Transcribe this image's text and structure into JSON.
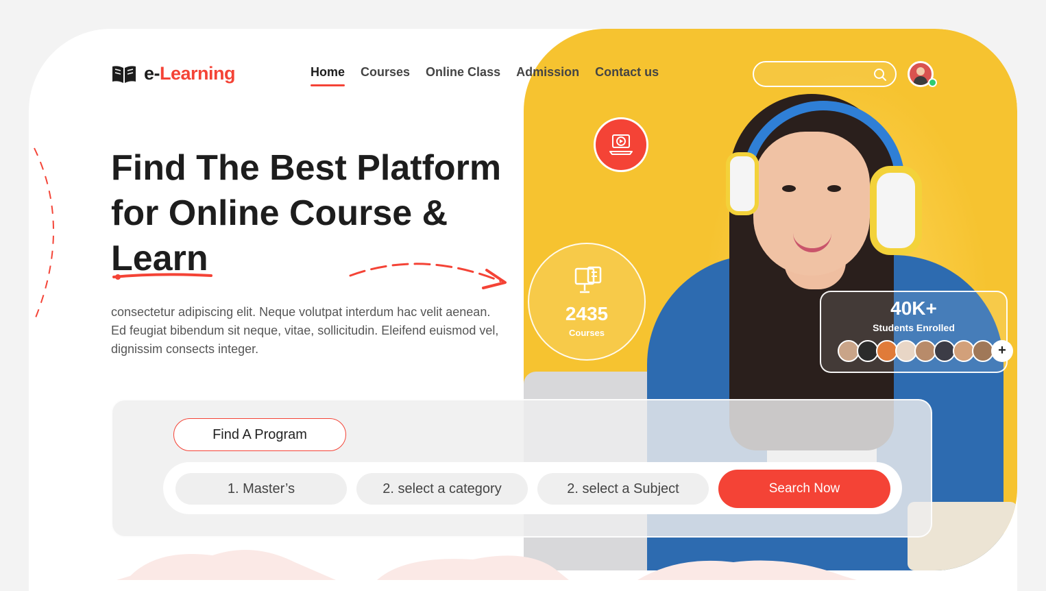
{
  "brand": {
    "name_prefix": "e-",
    "name_accent": "Learning"
  },
  "nav": {
    "items": [
      {
        "label": "Home",
        "active": true
      },
      {
        "label": "Courses"
      },
      {
        "label": "Online Class"
      },
      {
        "label": "Admission"
      },
      {
        "label": "Contact us"
      }
    ]
  },
  "search": {
    "placeholder": ""
  },
  "hero": {
    "headline_line1": "Find The Best Platform",
    "headline_line2": "for Online Course &",
    "headline_line3": "Learn",
    "description": "consectetur adipiscing elit. Neque volutpat interdum hac velit aenean. Ed feugiat bibendum sit neque, vitae, sollicitudin. Eleifend euismod vel, dignissim consects integer."
  },
  "stats": {
    "courses_count": "2435",
    "courses_label": "Courses",
    "students_count": "40K+",
    "students_label": "Students Enrolled",
    "more_label": "+"
  },
  "finder": {
    "tab_label": "Find A Program",
    "filter_degree": "1. Master’s",
    "filter_category": "2. select a category",
    "filter_subject": "2. select a Subject",
    "search_button": "Search Now"
  },
  "colors": {
    "accent": "#f44336",
    "hero_yellow": "#f6c330",
    "text_dark": "#1d1d1d"
  }
}
